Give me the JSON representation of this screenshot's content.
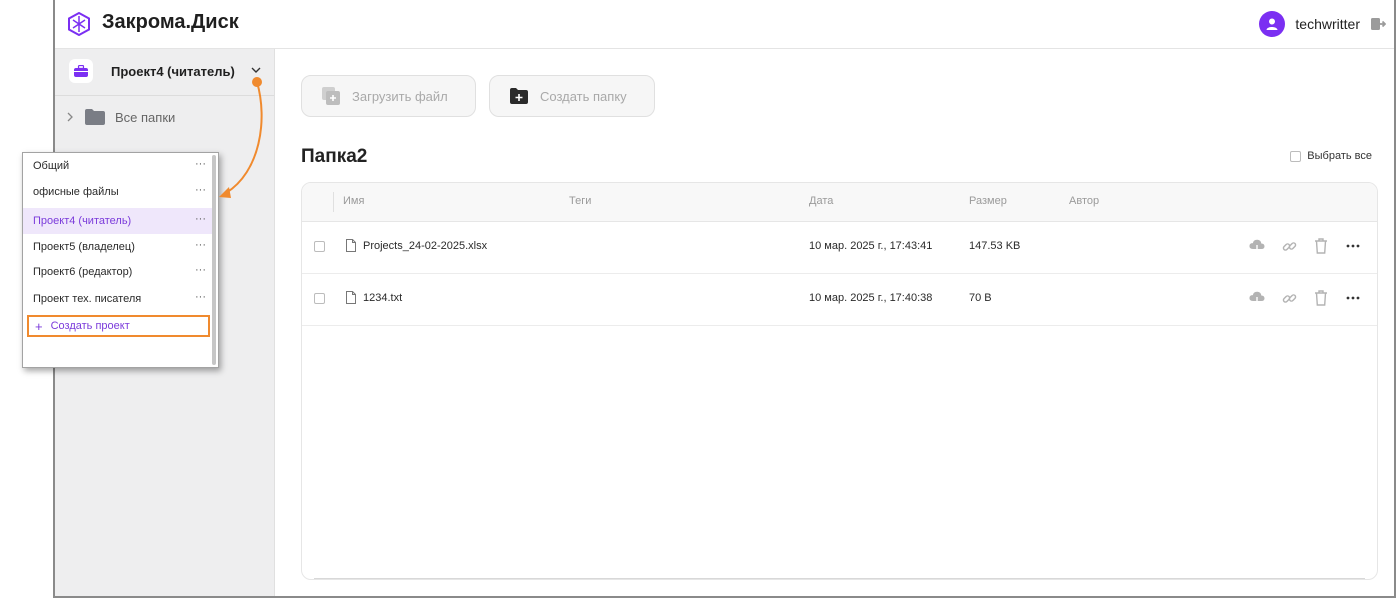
{
  "app": {
    "title": "Закрома.Диск",
    "accent": "#7b2ff2"
  },
  "user": {
    "name": "techwritter"
  },
  "sidebar": {
    "current_project": "Проект4 (читатель)",
    "all_folders_label": "Все папки"
  },
  "toolbar": {
    "upload_label": "Загрузить файл",
    "create_folder_label": "Создать папку"
  },
  "folder": {
    "title": "Папка2",
    "select_all_label": "Выбрать все"
  },
  "table": {
    "columns": {
      "name": "Имя",
      "tags": "Теги",
      "date": "Дата",
      "size": "Размер",
      "author": "Автор"
    },
    "rows": [
      {
        "name": "Projects_24-02-2025.xlsx",
        "tags": "",
        "date": "10 мар. 2025 г., 17:43:41",
        "size": "147.53 KB",
        "author": ""
      },
      {
        "name": "1234.txt",
        "tags": "",
        "date": "10 мар. 2025 г., 17:40:38",
        "size": "70 B",
        "author": ""
      }
    ]
  },
  "project_dropdown": {
    "items": [
      {
        "label": "Общий",
        "menu": "···"
      },
      {
        "label": "офисные файлы",
        "menu": "···"
      },
      {
        "label": "Проект4 (читатель)",
        "menu": "···",
        "active": true
      },
      {
        "label": "Проект5 (владелец)",
        "menu": "···"
      },
      {
        "label": "Проект6 (редактор)",
        "menu": "···"
      },
      {
        "label": "Проект тех. писателя",
        "menu": "···"
      }
    ],
    "create_label": "Создать проект",
    "create_plus": "+"
  },
  "colors": {
    "annotation": "#f08a2e",
    "active_text": "#7b3bdb"
  },
  "icons": [
    "logo-icon",
    "avatar-icon",
    "logout-icon",
    "briefcase-icon",
    "chevron-down-icon",
    "chevron-right-icon",
    "folder-icon",
    "upload-icon",
    "new-folder-icon",
    "file-icon",
    "cloud-download-icon",
    "link-icon",
    "trash-icon",
    "more-icon"
  ]
}
